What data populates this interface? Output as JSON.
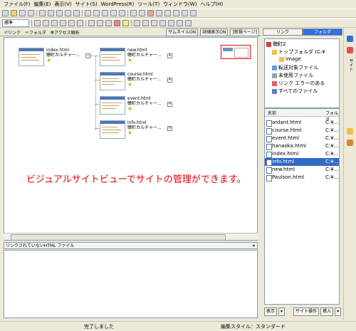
{
  "menu": [
    "ファイル(F)",
    "編集(E)",
    "表示(V)",
    "サイト(S)",
    "WordPress(R)",
    "ツール(T)",
    "ウィンドウ(W)",
    "ヘルプ(H)"
  ],
  "toolbar2": {
    "style_combo": "標準"
  },
  "view_toolbar": {
    "link_label": "リンク",
    "folder_label": "フォルダ",
    "access_label": "アクセス解析",
    "thumbnail_toggle": "サムネイルON",
    "detail_toggle": "詳細表示ON",
    "page_select": "[新規ページ]"
  },
  "site_view": {
    "root": {
      "file": "index.html",
      "title": "聴町カルチャー..."
    },
    "children": [
      {
        "file": "new.html",
        "title": "聴町カルチャー..."
      },
      {
        "file": "course.html",
        "title": "聴町カルチャー..."
      },
      {
        "file": "event.html",
        "title": "聴町カルチャー..."
      },
      {
        "file": "info.html",
        "title": "聴町カルチャー..."
      }
    ],
    "overlay_text": "ビジュアルサイトビューでサイトの管理ができます。"
  },
  "unlinked_panel": {
    "label": "リンクされていないHTML ファイル"
  },
  "right_panel": {
    "tabs": [
      {
        "label": "リンク",
        "active": false
      },
      {
        "label": "フォルダ",
        "active": true
      }
    ],
    "tree": [
      "聴町2",
      "トップフォルダ (C:¥",
      "image",
      "転送対象ファイル",
      "未使用ファイル",
      "リンク エラーのある",
      "すべてのファイル"
    ],
    "file_list_headers": {
      "name": "名前",
      "folder": "フォルダ"
    },
    "files": [
      {
        "name": "ardant.html",
        "folder": "C:¥...",
        "selected": false
      },
      {
        "name": "course.html",
        "folder": "C:¥...",
        "selected": false
      },
      {
        "name": "event.html",
        "folder": "C:¥...",
        "selected": false
      },
      {
        "name": "hanaoka.html",
        "folder": "C:¥...",
        "selected": false
      },
      {
        "name": "index.html",
        "folder": "C:¥...",
        "selected": false
      },
      {
        "name": "info.html",
        "folder": "C:¥...",
        "selected": true
      },
      {
        "name": "new.html",
        "folder": "C:¥...",
        "selected": false
      },
      {
        "name": "Paulson.html",
        "folder": "C:¥...",
        "selected": false
      }
    ],
    "buttons": {
      "view": "表示",
      "site_ops": "サイト操作",
      "insert": "挿入"
    }
  },
  "side_strip": {
    "label": "サイト"
  },
  "status": {
    "left": "完了しました",
    "right": "編集スタイル：スタンダード"
  },
  "colors": {
    "accent": "#2e6ee6",
    "overlay": "#e00000",
    "selection": "#316ac5"
  }
}
